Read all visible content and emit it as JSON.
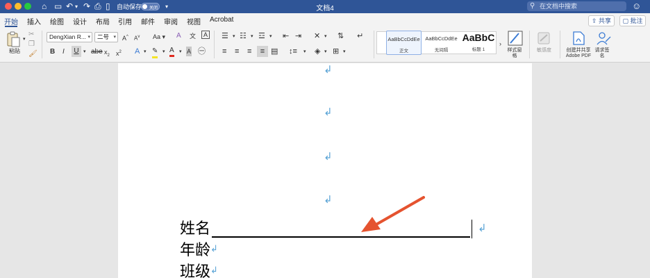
{
  "titlebar": {
    "autosave_label": "自动保存",
    "autosave_state": "关闭",
    "doc_title": "文档4",
    "search_placeholder": "在文档中搜索"
  },
  "tabs": [
    {
      "label": "开始",
      "active": true
    },
    {
      "label": "插入"
    },
    {
      "label": "绘图"
    },
    {
      "label": "设计"
    },
    {
      "label": "布局"
    },
    {
      "label": "引用"
    },
    {
      "label": "邮件"
    },
    {
      "label": "审阅"
    },
    {
      "label": "视图"
    },
    {
      "label": "Acrobat"
    }
  ],
  "share_label": "共享",
  "comment_label": "批注",
  "ribbon": {
    "paste_label": "粘贴",
    "font_name": "DengXian R...",
    "font_size": "二号",
    "styles": [
      {
        "sample": "AaBbCcDdEe",
        "name": "正文"
      },
      {
        "sample": "AaBbCcDdEe",
        "name": "无间隔"
      },
      {
        "sample": "AaBbC",
        "name": "标题 1"
      }
    ],
    "styles_pane_label": "样式窗格",
    "sensitivity_label": "敏感度",
    "create_pdf_label": "创建并共享 Adobe PDF",
    "request_sign_label": "请求签名"
  },
  "document": {
    "lines": [
      {
        "text": "姓名"
      },
      {
        "text": "年龄"
      },
      {
        "text": "班级"
      }
    ]
  },
  "colors": {
    "titlebar": "#2f5597",
    "pilcrow": "#5aa4d6",
    "arrow": "#e5532f"
  }
}
